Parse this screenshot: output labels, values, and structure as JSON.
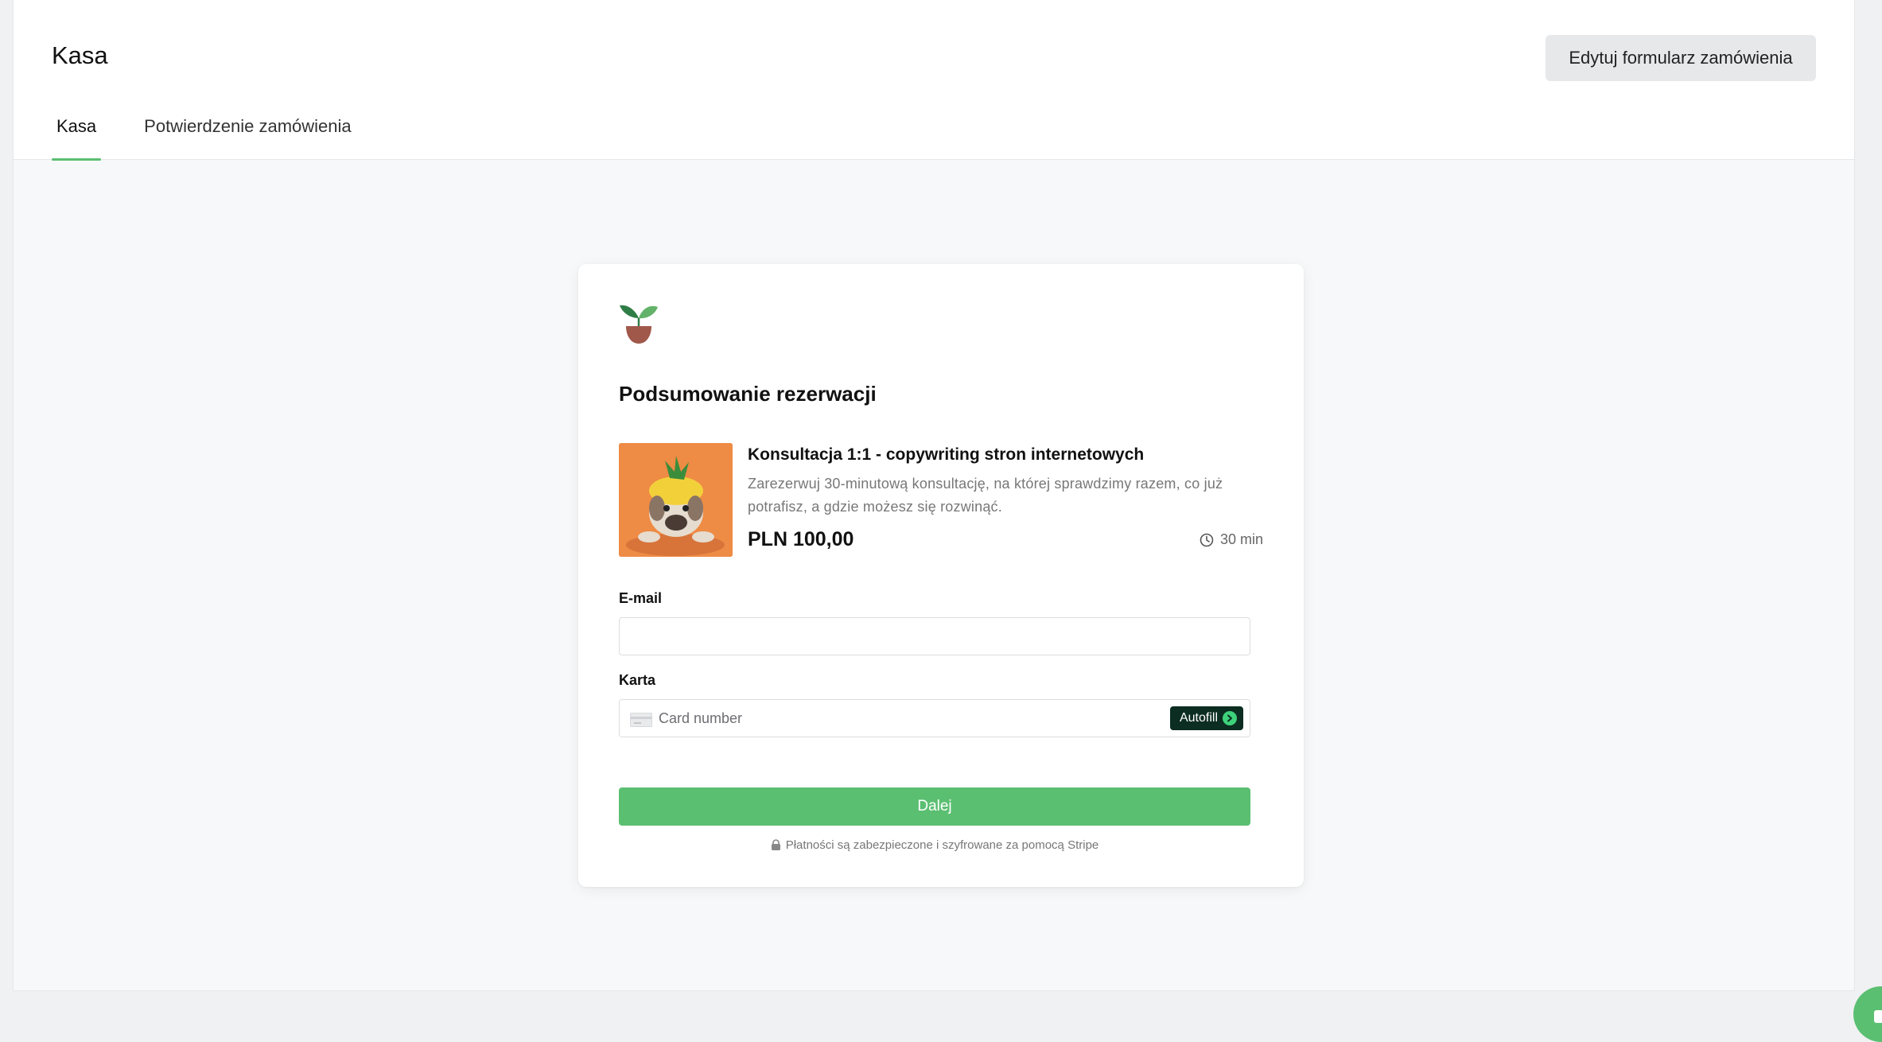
{
  "header": {
    "title": "Kasa",
    "edit_button": "Edytuj formularz zamówienia",
    "tabs": [
      {
        "label": "Kasa",
        "active": true
      },
      {
        "label": "Potwierdzenie zamówienia",
        "active": false
      }
    ]
  },
  "checkout": {
    "logo_icon": "sprout-in-pot-icon",
    "summary_title": "Podsumowanie rezerwacji",
    "product": {
      "image_icon": "dog-with-pineapple-hat-photo",
      "name": "Konsultacja 1:1 - copywriting stron internetowych",
      "description": "Zarezerwuj 30-minutową konsultację, na której sprawdzimy razem, co już potrafisz, a gdzie możesz się rozwinąć.",
      "price": "PLN 100,00",
      "duration": "30 min"
    },
    "email": {
      "label": "E-mail",
      "value": "",
      "placeholder": ""
    },
    "card": {
      "label": "Karta",
      "placeholder": "Card number",
      "autofill_label": "Autofill"
    },
    "submit_label": "Dalej",
    "secure_note": "Płatności są zabezpieczone i szyfrowane za pomocą Stripe"
  },
  "colors": {
    "accent": "#5bbf72",
    "autofill_bg": "#0c2d21",
    "button_gray": "#e7e8ea"
  }
}
